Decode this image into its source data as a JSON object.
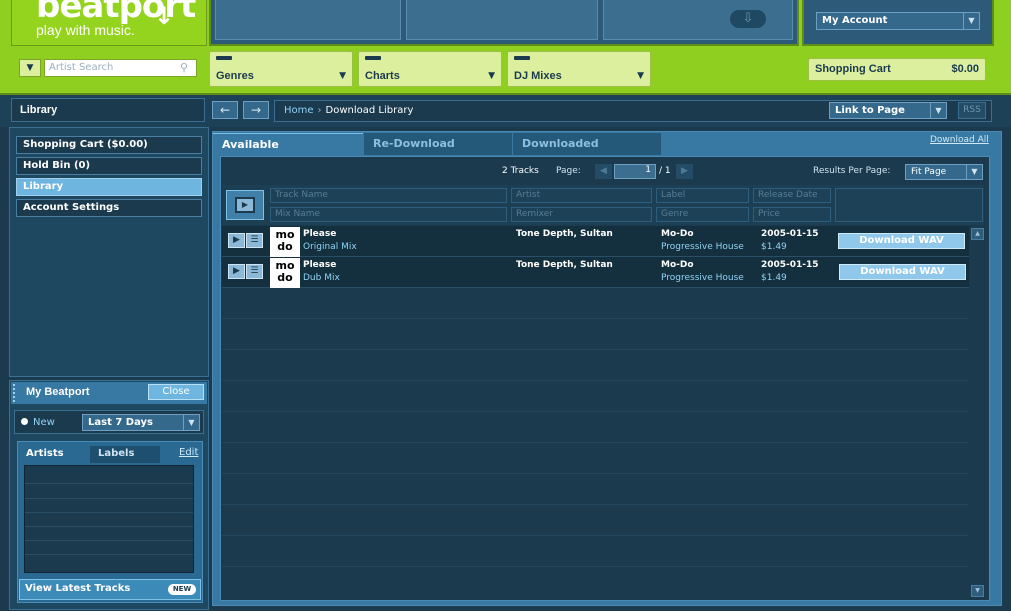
{
  "brand": {
    "logo_text": "beatport",
    "tagline": "play with music."
  },
  "account": {
    "label": "My Account"
  },
  "search": {
    "placeholder": "Artist Search"
  },
  "nav_tabs": [
    {
      "label": "Genres"
    },
    {
      "label": "Charts"
    },
    {
      "label": "DJ Mixes"
    }
  ],
  "cart": {
    "label": "Shopping Cart",
    "amount": "$0.00"
  },
  "header": {
    "section": "Library",
    "crumb_home": "Home",
    "crumb_current": "Download Library",
    "link_to_page": "Link to Page",
    "rss": "RSS"
  },
  "sidebar": {
    "items": [
      {
        "label": "Shopping Cart ($0.00)"
      },
      {
        "label": "Hold Bin (0)"
      },
      {
        "label": "Library"
      },
      {
        "label": "Account Settings"
      }
    ]
  },
  "my_beatport": {
    "title": "My Beatport",
    "close": "Close",
    "new_label": "New",
    "range": "Last 7 Days",
    "tab_artists": "Artists",
    "tab_labels": "Labels",
    "edit": "Edit",
    "view_latest": "View Latest Tracks",
    "new_badge": "NEW"
  },
  "tabs": {
    "available": "Available",
    "redownload": "Re-Download",
    "downloaded": "Downloaded",
    "download_all": "Download All"
  },
  "pager": {
    "tracks": "2 Tracks",
    "page_label": "Page:",
    "page": "1",
    "of": "/ 1",
    "results_label": "Results Per Page:",
    "results": "Fit Page"
  },
  "filters": {
    "track_name": "Track Name",
    "mix_name": "Mix Name",
    "artist": "Artist",
    "remixer": "Remixer",
    "label": "Label",
    "genre": "Genre",
    "release_date": "Release Date",
    "price": "Price"
  },
  "tracks": [
    {
      "cover": "mo do",
      "name": "Please",
      "mix": "Original Mix",
      "artists": "Tone Depth,  Sultan",
      "label": "Mo-Do",
      "genre": "Progressive House",
      "date": "2005-01-15",
      "price": "$1.49",
      "action": "Download WAV"
    },
    {
      "cover": "mo do",
      "name": "Please",
      "mix": "Dub Mix",
      "artists": "Tone Depth,  Sultan",
      "label": "Mo-Do",
      "genre": "Progressive House",
      "date": "2005-01-15",
      "price": "$1.49",
      "action": "Download WAV"
    }
  ],
  "colors": {
    "brand_green": "#8fcf1f",
    "panel_blue": "#3779a2",
    "dark_bg": "#1b3a4e",
    "link_blue": "#8fd2f5"
  }
}
